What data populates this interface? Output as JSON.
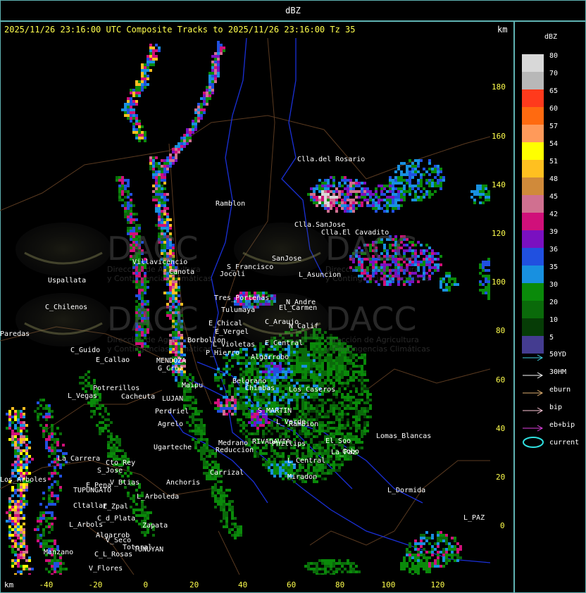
{
  "window": {
    "title": "dBZ"
  },
  "header": {
    "title": "2025/11/26 23:16:00 UTC Composite Tracks to 2025/11/26 23:16:00 Tz 35",
    "units_right": "km",
    "units_bottom": "km"
  },
  "axes": {
    "x_ticks": [
      "-40",
      "-20",
      "0",
      "20",
      "40",
      "60",
      "80",
      "100",
      "120"
    ],
    "y_ticks": [
      "180",
      "160",
      "140",
      "120",
      "100",
      "80",
      "60",
      "40",
      "20",
      "0"
    ]
  },
  "legend": {
    "title": "dBZ",
    "levels": [
      {
        "label": "80",
        "color": "#d8d8d8"
      },
      {
        "label": "70",
        "color": "#b8b8b8"
      },
      {
        "label": "65",
        "color": "#ff3a1c"
      },
      {
        "label": "60",
        "color": "#ff6a10"
      },
      {
        "label": "57",
        "color": "#ff9a5a"
      },
      {
        "label": "54",
        "color": "#ffff00"
      },
      {
        "label": "51",
        "color": "#ffc020"
      },
      {
        "label": "48",
        "color": "#d08a3a"
      },
      {
        "label": "45",
        "color": "#d07090"
      },
      {
        "label": "42",
        "color": "#d0107a"
      },
      {
        "label": "39",
        "color": "#7a10c0"
      },
      {
        "label": "36",
        "color": "#2050e0"
      },
      {
        "label": "35",
        "color": "#1890e0"
      },
      {
        "label": "30",
        "color": "#0a8a0a"
      },
      {
        "label": "20",
        "color": "#0a6a0a"
      },
      {
        "label": "10",
        "color": "#063c06"
      },
      {
        "label": "5",
        "color": "#443c90"
      }
    ],
    "tracks": [
      {
        "label": "50YD",
        "color": "#40d0e0"
      },
      {
        "label": "30HM",
        "color": "#ffffff"
      },
      {
        "label": "eburn",
        "color": "#e0b070"
      },
      {
        "label": "bip",
        "color": "#ffc8d8"
      },
      {
        "label": "eb+bip",
        "color": "#e040e0"
      },
      {
        "label": "current",
        "color": "#30e0e0"
      }
    ]
  },
  "watermark": {
    "brand": "DACC",
    "line1": "Dirección de Agricultura",
    "line2": "y Contingencias Climáticas"
  },
  "places": [
    {
      "name": "Clla.del Rosario"
    },
    {
      "name": "Ramblon"
    },
    {
      "name": "Clla.SanJose"
    },
    {
      "name": "Clla.El Cavadito"
    },
    {
      "name": "Villavicencio"
    },
    {
      "name": "Canota"
    },
    {
      "name": "S_Francisco"
    },
    {
      "name": "SanJose"
    },
    {
      "name": "L_Asuncion"
    },
    {
      "name": "Jocoli"
    },
    {
      "name": "Uspallata"
    },
    {
      "name": "Tres_Porteñas"
    },
    {
      "name": "Tulumaya"
    },
    {
      "name": "C_Chilenos"
    },
    {
      "name": "N_Andre"
    },
    {
      "name": "El_Carmen"
    },
    {
      "name": "E_Chical"
    },
    {
      "name": "E_Vergel"
    },
    {
      "name": "C_Araujo"
    },
    {
      "name": "N_Calif"
    },
    {
      "name": "Paredas"
    },
    {
      "name": "Borbollon"
    },
    {
      "name": "L_Violetas"
    },
    {
      "name": "E_Central"
    },
    {
      "name": "C_Guido"
    },
    {
      "name": "E_Callao"
    },
    {
      "name": "MENDOZA"
    },
    {
      "name": "P_Hierro"
    },
    {
      "name": "Algarrobo"
    },
    {
      "name": "G_Cruz"
    },
    {
      "name": "Maipu"
    },
    {
      "name": "Belgrano"
    },
    {
      "name": "Chimbas"
    },
    {
      "name": "Los_Caseros"
    },
    {
      "name": "Potrerillos"
    },
    {
      "name": "L_Vegas"
    },
    {
      "name": "Cacheuta"
    },
    {
      "name": "LUJAN"
    },
    {
      "name": "Perdriel"
    },
    {
      "name": "S_MARTIN"
    },
    {
      "name": "Agrelo"
    },
    {
      "name": "L_Verde"
    },
    {
      "name": "Rambion"
    },
    {
      "name": "Lomas_Blancas"
    },
    {
      "name": "Ugarteche"
    },
    {
      "name": "Medrano"
    },
    {
      "name": "Reduccion"
    },
    {
      "name": "RIVADAVIA"
    },
    {
      "name": "Phillips"
    },
    {
      "name": "La_Paz"
    },
    {
      "name": "La_Carrera"
    },
    {
      "name": "Cto_Rey"
    },
    {
      "name": "S_Jose"
    },
    {
      "name": "Carrizal"
    },
    {
      "name": "L_Central"
    },
    {
      "name": "Los_Arboles"
    },
    {
      "name": "V_Btias"
    },
    {
      "name": "Anchoris"
    },
    {
      "name": "E_Pena"
    },
    {
      "name": "TUPUNGATO"
    },
    {
      "name": "Miradon"
    },
    {
      "name": "L_Dormida"
    },
    {
      "name": "L_Arboleda"
    },
    {
      "name": "Cltallar"
    },
    {
      "name": "E_Zpal"
    },
    {
      "name": "C_d_Plata"
    },
    {
      "name": "L_Arbols"
    },
    {
      "name": "Zapata"
    },
    {
      "name": "Algarrob"
    },
    {
      "name": "V_Seco"
    },
    {
      "name": "Totoral"
    },
    {
      "name": "TUNUYAN"
    },
    {
      "name": "Manzano"
    },
    {
      "name": "C_L_Rosas"
    },
    {
      "name": "V_Flores"
    },
    {
      "name": "L_PAZ"
    },
    {
      "name": "Cobo"
    },
    {
      "name": "El_Soo"
    }
  ]
}
